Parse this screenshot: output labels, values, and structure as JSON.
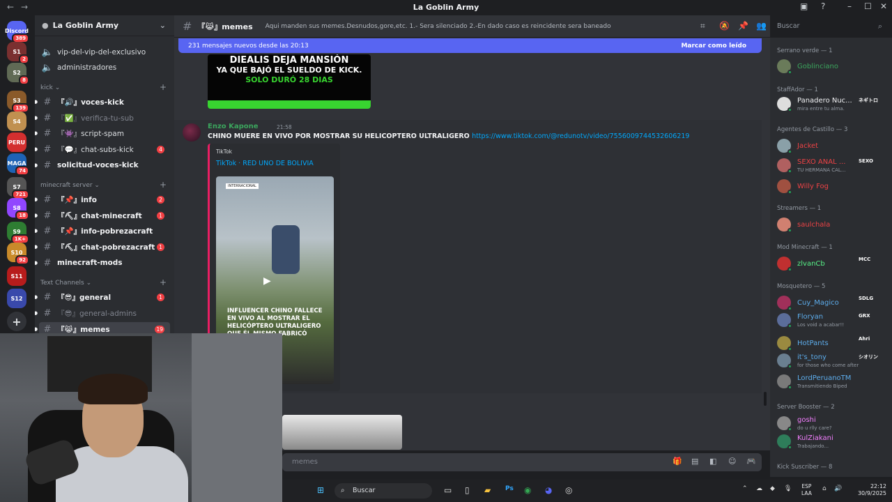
{
  "window": {
    "title": "La Goblin Army"
  },
  "servers": [
    {
      "label": "Discord",
      "badge": "389",
      "color": "#5865f2"
    },
    {
      "label": "S1",
      "badge": "2",
      "color": "#7a3030"
    },
    {
      "label": "S2",
      "badge": "8",
      "color": "#606a55"
    },
    {
      "label": "S3",
      "badge": "139",
      "color": "#8a5a2a"
    },
    {
      "label": "S4",
      "badge": "",
      "color": "#c09050"
    },
    {
      "label": "PERU",
      "badge": "",
      "color": "#d32f2f"
    },
    {
      "label": "MAGA",
      "badge": "74",
      "color": "#1e63b5"
    },
    {
      "label": "S7",
      "badge": "721",
      "color": "#555"
    },
    {
      "label": "S8",
      "badge": "18",
      "color": "#9146ff"
    },
    {
      "label": "S9",
      "badge": "1K+",
      "color": "#2e7d32"
    },
    {
      "label": "S10",
      "badge": "92",
      "color": "#c98a2a"
    },
    {
      "label": "S11",
      "badge": "",
      "color": "#b71c1c"
    },
    {
      "label": "S12",
      "badge": "",
      "color": "#3949ab"
    }
  ],
  "guild": {
    "name": "La Goblin Army"
  },
  "channels": [
    {
      "name": "vip-del-vip-del-exclusivo",
      "badge": "",
      "style": "voice"
    },
    {
      "name": "administradores",
      "badge": "",
      "style": "voice"
    },
    {
      "category": "kick"
    },
    {
      "name": "『🔊』voces-kick",
      "badge": "",
      "style": "big"
    },
    {
      "name": "『✅』verifica-tu-sub",
      "badge": "",
      "style": "muted"
    },
    {
      "name": "『👾』script-spam",
      "badge": "",
      "style": "normal"
    },
    {
      "name": "『💬』chat-subs-kick",
      "badge": "4",
      "style": "normal"
    },
    {
      "name": "solicitud-voces-kick",
      "badge": "",
      "style": "big"
    },
    {
      "category": "minecraft server"
    },
    {
      "name": "『📌』info",
      "badge": "2",
      "style": "big"
    },
    {
      "name": "『⛏』chat-minecraft",
      "badge": "1",
      "style": "big"
    },
    {
      "name": "『📌』info-pobrezacraft",
      "badge": "",
      "style": "big"
    },
    {
      "name": "『⛏』chat-pobrezacraft",
      "badge": "1",
      "style": "big"
    },
    {
      "name": "minecraft-mods",
      "badge": "",
      "style": "big"
    },
    {
      "category": "Text Channels"
    },
    {
      "name": "『😎』general",
      "badge": "1",
      "style": "big"
    },
    {
      "name": "『😎』general-admins",
      "badge": "",
      "style": "muted"
    },
    {
      "name": "『😹』memes",
      "badge": "19",
      "style": "sel"
    }
  ],
  "header": {
    "channel": "『😹』memes",
    "topic": "Aqui manden sus memes.Desnudos,gore,etc. 1.- Sera silenciado 2.-En dado caso es reincidente sera baneado"
  },
  "search": {
    "placeholder": "Buscar"
  },
  "new_messages": {
    "text": "231 mensajes nuevos desde las 20:13",
    "action": "Marcar como leído"
  },
  "top_image": {
    "lines": [
      "DIEALIS DEJA MANSIÓN",
      "YA QUE BAJÓ EL SUELDO DE KICK.",
      "SOLO DURÓ 28 DIAS"
    ]
  },
  "message": {
    "author": "Enzo Kapone",
    "time": "21:58",
    "text": "CHINO MUERE EN VIVO POR MOSTRAR SU HELICOPTERO ULTRALIGERO",
    "link": "https://www.tiktok.com/@redunotv/video/7556009744532606219",
    "embed": {
      "provider": "TikTok",
      "title": "TikTok · RED UNO DE BOLIVIA",
      "video_caption": "INFLUENCER CHINO FALLECE EN VIVO AL MOSTRAR EL HELICÓPTERO ULTRALIGERO QUE ÉL MISMO FABRICÓ",
      "tag": "INTERNACIONAL"
    }
  },
  "composer": {
    "placeholder": "memes"
  },
  "members": [
    {
      "group": "Serrano verde — 1"
    },
    {
      "name": "Goblinciano",
      "color": "#3ba55d",
      "status": "",
      "tag": ""
    },
    {
      "group": "StaffAdor — 1"
    },
    {
      "name": "Panadero Nuc...",
      "color": "#f2f3f5",
      "status": "mira entre tu alma.",
      "tag": "ネギトロ"
    },
    {
      "group": "Agentes de Castillo — 3"
    },
    {
      "name": "Jacket",
      "color": "#ed4245",
      "status": "",
      "tag": ""
    },
    {
      "name": "SEXO ANAL ...",
      "color": "#ed4245",
      "status": "TU HERMANA CAL...",
      "tag": "SEXO"
    },
    {
      "name": "Willy Fog",
      "color": "#ed4245",
      "status": "",
      "tag": ""
    },
    {
      "group": "Streamers — 1"
    },
    {
      "name": "saulchala",
      "color": "#ed4245",
      "status": "",
      "tag": ""
    },
    {
      "group": "Mod Minecraft — 1"
    },
    {
      "name": "zlvanCb",
      "color": "#57f287",
      "status": "",
      "tag": "MCC"
    },
    {
      "group": "Mosquetero — 5"
    },
    {
      "name": "Cuy_Magico",
      "color": "#5dadec",
      "status": "",
      "tag": "SDLG"
    },
    {
      "name": "Floryan",
      "color": "#5dadec",
      "status": "Los void a acabar!!",
      "tag": "GRX"
    },
    {
      "name": "HotPants",
      "color": "#5dadec",
      "status": "",
      "tag": "Ahri"
    },
    {
      "name": "it's_tony",
      "color": "#5dadec",
      "status": "for those who come after",
      "tag": "シオリン"
    },
    {
      "name": "LordPeruanoTM",
      "color": "#5dadec",
      "status": "Transmitiendo Biped",
      "tag": ""
    },
    {
      "group": "Server Booster — 2"
    },
    {
      "name": "goshi",
      "color": "#f47fff",
      "status": "do u rlly care?",
      "tag": ""
    },
    {
      "name": "KulZiakani",
      "color": "#f47fff",
      "status": "Trabajando...",
      "tag": ""
    },
    {
      "group": "Kick Suscriber — 8"
    }
  ],
  "taskbar": {
    "search": "Buscar",
    "lang1": "ESP",
    "lang2": "LAA",
    "time": "22:12",
    "date": "30/9/2025"
  }
}
